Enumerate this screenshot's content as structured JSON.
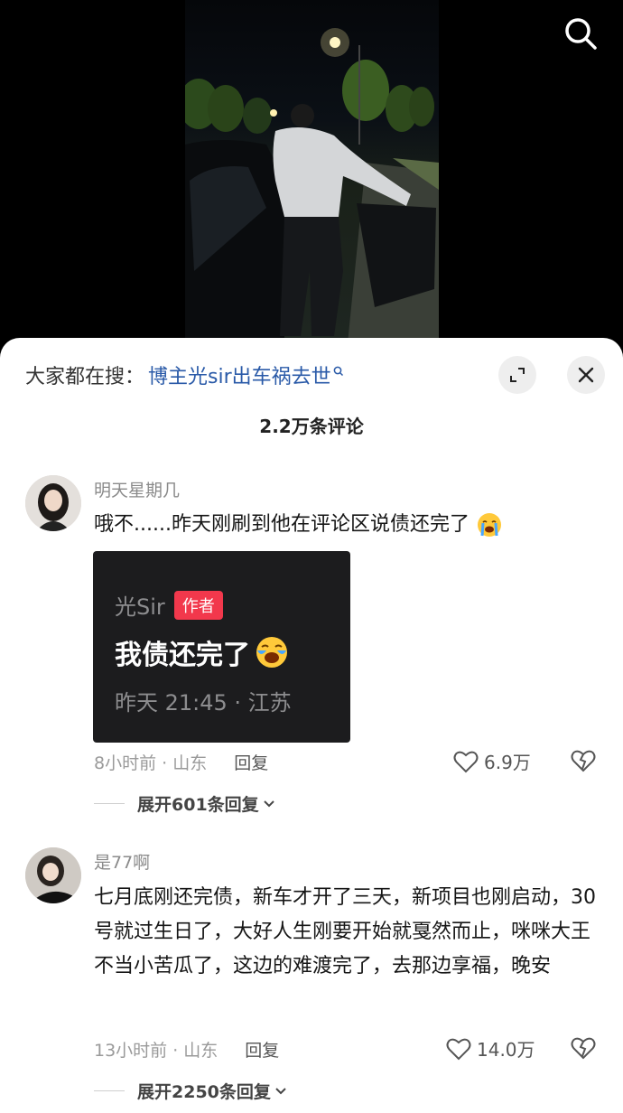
{
  "header": {
    "search_icon": "search-icon"
  },
  "sheet": {
    "search_label": "大家都在搜：",
    "search_keyword": "博主光sir出车祸去世",
    "comment_count": "2.2万条评论",
    "icons": {
      "expand": "expand-icon",
      "close": "close-icon"
    }
  },
  "comments": [
    {
      "username": "明天星期几",
      "text": "哦不......昨天刚刷到他在评论区说债还完了",
      "emoji": "crying-face",
      "quote": {
        "author": "光Sir",
        "tag": "作者",
        "text": "我债还完了",
        "meta": "昨天 21:45 · 江苏"
      },
      "time_location": "8小时前 · 山东",
      "reply_label": "回复",
      "likes": "6.9万",
      "expand_label": "展开601条回复"
    },
    {
      "username": "是77啊",
      "text": "七月底刚还完债，新车才开了三天，新项目也刚启动，30号就过生日了，大好人生刚要开始就戛然而止，咪咪大王不当小苦瓜了，这边的难渡完了，去那边享福，晚安",
      "time_location": "13小时前 · 山东",
      "reply_label": "回复",
      "likes": "14.0万",
      "expand_label": "展开2250条回复"
    }
  ],
  "colors": {
    "keyword": "#2a5aa8",
    "author_tag": "#f2384c"
  }
}
